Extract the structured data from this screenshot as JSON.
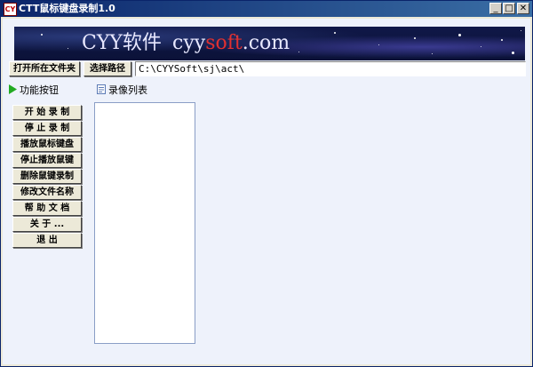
{
  "window": {
    "title": "CTT鼠标键盘录制1.0",
    "app_icon_text": "CY",
    "controls": {
      "minimize": "_",
      "maximize": "□",
      "close": "✕"
    }
  },
  "banner": {
    "brand_cn": "CYY软件",
    "domain_part1": "cyy",
    "domain_part2": "soft",
    "domain_part3": ".com",
    "domain_color": "#ffffff",
    "accent_color": "#e03030"
  },
  "toolbar": {
    "open_folder_label": "打开所在文件夹",
    "choose_path_label": "选择路径",
    "path_value": "C:\\CYYSoft\\sj\\act\\"
  },
  "left_panel": {
    "header": "功能按钮",
    "header_icon": "green-play-triangle",
    "buttons": [
      "开 始 录 制",
      "停 止 录 制",
      "播放鼠标键盘",
      "停止播放鼠键",
      "删除鼠键录制",
      "修改文件名称",
      "帮 助 文 档",
      "关 于 ...",
      "退   出"
    ]
  },
  "list_panel": {
    "header": "录像列表",
    "header_icon": "document-icon"
  }
}
